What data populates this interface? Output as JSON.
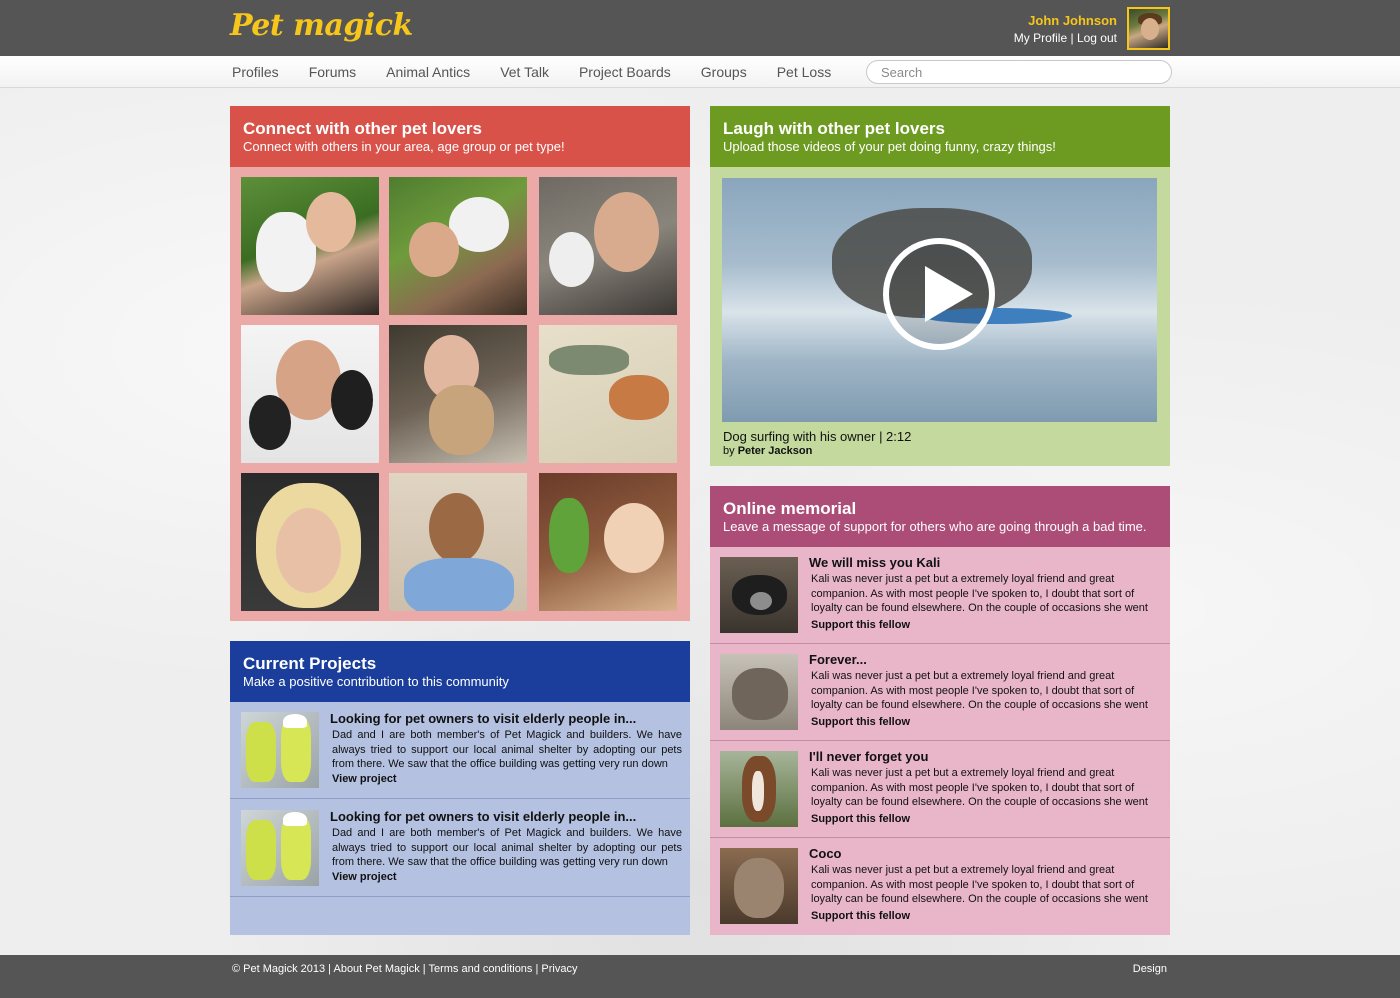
{
  "brand": {
    "logo_text": "Pet magick",
    "color": "#f6c61a"
  },
  "user": {
    "name": "John Johnson",
    "profile_link": "My Profile",
    "separator": "|",
    "logout_link": "Log out"
  },
  "nav": {
    "items": [
      "Profiles",
      "Forums",
      "Animal Antics",
      "Vet Talk",
      "Project Boards",
      "Groups",
      "Pet Loss"
    ],
    "search_placeholder": "Search"
  },
  "connect": {
    "title": "Connect with other pet lovers",
    "subtitle": "Connect with others in your area, age group or pet type!",
    "color": "#d9524a"
  },
  "laugh": {
    "title": "Laugh with other pet lovers",
    "subtitle": "Upload those videos of your pet doing funny, crazy things!",
    "video_title": "Dog surfing with his owner | 2:12",
    "video_by_prefix": "by",
    "video_author": "Peter Jackson",
    "color": "#6d9b21"
  },
  "memorial": {
    "title": "Online memorial",
    "subtitle": "Leave a message of support for others who are going through a bad time.",
    "color": "#ac4d78",
    "items": [
      {
        "title": "We will miss you Kali",
        "text": "Kali was never just a pet but a extremely loyal friend and great companion. As with most people I've spoken to, I doubt that sort of loyalty can be found elsewhere. On the couple of occasions she went missin...",
        "link": "Support this fellow"
      },
      {
        "title": "Forever...",
        "text": "Kali was never just a pet but a extremely loyal friend and great companion. As with most people I've spoken to, I doubt that sort of loyalty can be found elsewhere. On the couple of occasions she went missin...",
        "link": "Support this fellow"
      },
      {
        "title": "I'll never forget you",
        "text": "Kali was never just a pet but a extremely loyal friend and great companion. As with most people I've spoken to, I doubt that sort of loyalty can be found elsewhere. On the couple of occasions she went missin...",
        "link": "Support this fellow"
      },
      {
        "title": "Coco",
        "text": "Kali was never just a pet but a extremely loyal friend and great companion. As with most people I've spoken to, I doubt that sort of loyalty can be found elsewhere. On the couple of occasions she went missin...",
        "link": "Support this fellow"
      }
    ]
  },
  "projects": {
    "title": "Current Projects",
    "subtitle": "Make a positive contribution to this community",
    "color": "#1b3e9c",
    "items": [
      {
        "title": "Looking for pet owners to visit elderly people in...",
        "text": "Dad and I are both member's of Pet Magick and builders. We have always tried to support our local animal shelter by adopting our pets from there. We saw that the office building was getting very run down",
        "link": "View project"
      },
      {
        "title": "Looking for pet owners to visit elderly people in...",
        "text": "Dad and I are both member's of Pet Magick and builders. We have always tried to support our local animal shelter by adopting our pets from there. We saw that the office building was getting very run down",
        "link": "View project"
      }
    ]
  },
  "footer": {
    "copyright": "© Pet Magick 2013",
    "about": "About Pet Magick",
    "terms": "Terms and conditions",
    "privacy": "Privacy",
    "separator": "|",
    "right": "Design"
  }
}
